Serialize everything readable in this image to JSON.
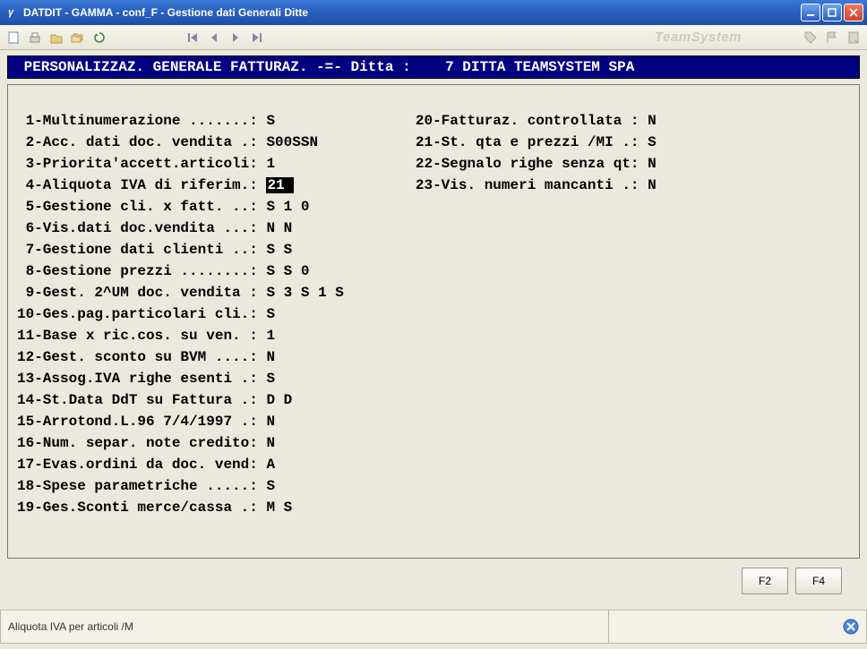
{
  "window": {
    "title": "DATDIT - GAMMA - conf_F - Gestione dati Generali Ditte"
  },
  "brand": "TeamSystem",
  "header": {
    "text": " PERSONALIZZAZ. GENERALE FATTURAZ. -=- Ditta :    7 DITTA TEAMSYSTEM SPA "
  },
  "active_field_index": 4,
  "left_rows": [
    {
      "num": " 1",
      "label": "-Multinumerazione .......: ",
      "value": "S"
    },
    {
      "num": " 2",
      "label": "-Acc. dati doc. vendita .: ",
      "value": "S00SSN"
    },
    {
      "num": " 3",
      "label": "-Priorita'accett.articoli: ",
      "value": "1"
    },
    {
      "num": " 4",
      "label": "-Aliquota IVA di riferim.: ",
      "value": "21 "
    },
    {
      "num": " 5",
      "label": "-Gestione cli. x fatt. ..: ",
      "value": "S 1 0"
    },
    {
      "num": " 6",
      "label": "-Vis.dati doc.vendita ...: ",
      "value": "N N"
    },
    {
      "num": " 7",
      "label": "-Gestione dati clienti ..: ",
      "value": "S S"
    },
    {
      "num": " 8",
      "label": "-Gestione prezzi ........: ",
      "value": "S S 0"
    },
    {
      "num": " 9",
      "label": "-Gest. 2^UM doc. vendita : ",
      "value": "S 3 S 1 S"
    },
    {
      "num": "10",
      "label": "-Ges.pag.particolari cli.: ",
      "value": "S"
    },
    {
      "num": "11",
      "label": "-Base x ric.cos. su ven. : ",
      "value": "1"
    },
    {
      "num": "12",
      "label": "-Gest. sconto su BVM ....: ",
      "value": "N"
    },
    {
      "num": "13",
      "label": "-Assog.IVA righe esenti .: ",
      "value": "S"
    },
    {
      "num": "14",
      "label": "-St.Data DdT su Fattura .: ",
      "value": "D D"
    },
    {
      "num": "15",
      "label": "-Arrotond.L.96 7/4/1997 .: ",
      "value": "N"
    },
    {
      "num": "16",
      "label": "-Num. separ. note credito: ",
      "value": "N"
    },
    {
      "num": "17",
      "label": "-Evas.ordini da doc. vend: ",
      "value": "A"
    },
    {
      "num": "18",
      "label": "-Spese parametriche .....: ",
      "value": "S"
    },
    {
      "num": "19",
      "label": "-Ges.Sconti merce/cassa .: ",
      "value": "M S"
    }
  ],
  "right_rows": [
    {
      "num": "20",
      "label": "-Fatturaz. controllata : ",
      "value": "N"
    },
    {
      "num": "21",
      "label": "-St. qta e prezzi /MI .: ",
      "value": "S"
    },
    {
      "num": "22",
      "label": "-Segnalo righe senza qt: ",
      "value": "N"
    },
    {
      "num": "23",
      "label": "-Vis. numeri mancanti .: ",
      "value": "N"
    }
  ],
  "buttons": {
    "f2": "F2",
    "f4": "F4"
  },
  "status": {
    "text": "Aliquota IVA per articoli /M"
  }
}
